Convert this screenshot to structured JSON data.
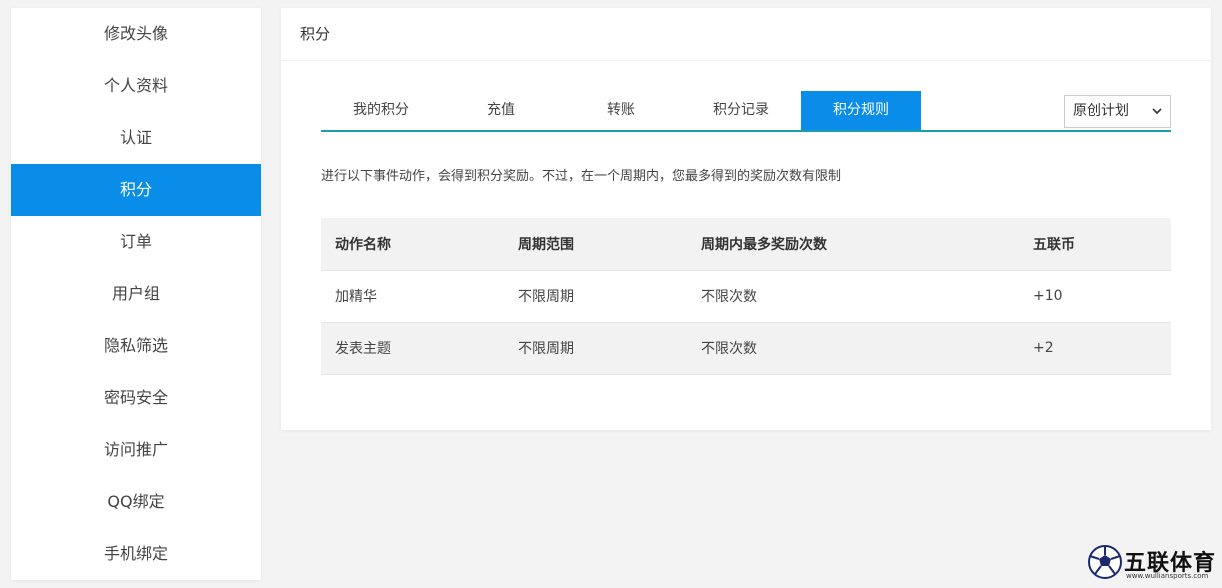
{
  "sidebar": {
    "items": [
      {
        "label": "修改头像"
      },
      {
        "label": "个人资料"
      },
      {
        "label": "认证"
      },
      {
        "label": "积分"
      },
      {
        "label": "订单"
      },
      {
        "label": "用户组"
      },
      {
        "label": "隐私筛选"
      },
      {
        "label": "密码安全"
      },
      {
        "label": "访问推广"
      },
      {
        "label": "QQ绑定"
      },
      {
        "label": "手机绑定"
      }
    ],
    "active_index": 3
  },
  "panel": {
    "title": "积分",
    "tabs": [
      {
        "label": "我的积分"
      },
      {
        "label": "充值"
      },
      {
        "label": "转账"
      },
      {
        "label": "积分记录"
      },
      {
        "label": "积分规则"
      }
    ],
    "active_tab": 4,
    "select": {
      "value": "原创计划"
    },
    "description": "进行以下事件动作，会得到积分奖励。不过，在一个周期内，您最多得到的奖励次数有限制",
    "table": {
      "headers": [
        "动作名称",
        "周期范围",
        "周期内最多奖励次数",
        "五联币"
      ],
      "rows": [
        [
          "加精华",
          "不限周期",
          "不限次数",
          "+10"
        ],
        [
          "发表主题",
          "不限周期",
          "不限次数",
          "+2"
        ]
      ]
    }
  },
  "logo": {
    "text": "五联体育",
    "sub": "www.wulliansports.com"
  },
  "colors": {
    "accent": "#0a8de8",
    "tab_line": "#1d9bb0",
    "background": "#f3f3f3"
  }
}
